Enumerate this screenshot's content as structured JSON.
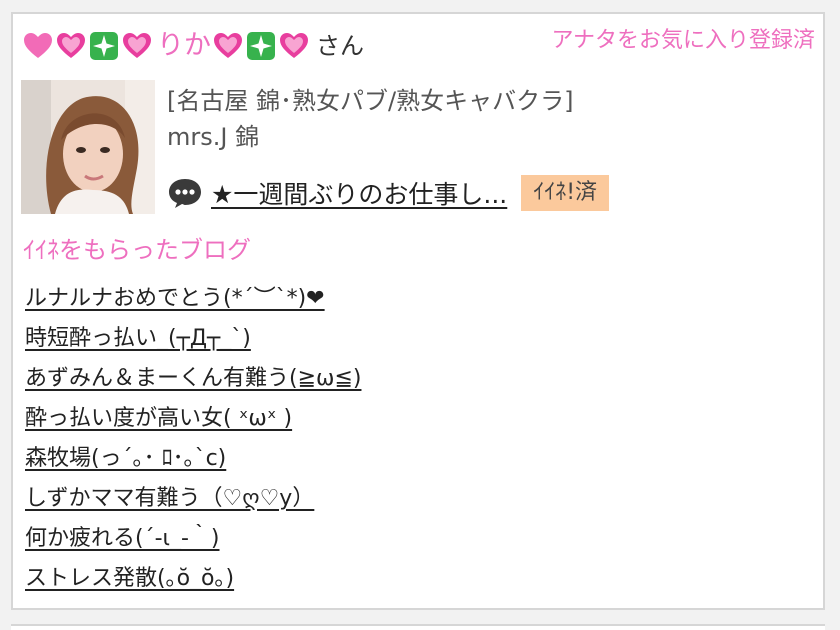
{
  "header": {
    "name": "りか",
    "honorific": "さん",
    "favorite_status": "アナタをお気に入り登録済"
  },
  "shop": {
    "category": "[名古屋 錦･熟女パブ/熟女キャバクラ]",
    "name": "mrs.J 錦"
  },
  "latest_blog": {
    "title": "★一週間ぶりのお仕事し...",
    "iine_badge": "ｲｲﾈ!済"
  },
  "liked_blogs": {
    "section_title": "ｲｲﾈをもらったブログ",
    "items": [
      "ルナルナおめでとう(*´︶`*)❤",
      "時短酔っ払い_(┬Д┬_`)",
      "あずみん＆まーくん有難う(≧ω≦)",
      "酔っ払い度が高い女( ˣωˣ )",
      "森牧場(っ´｡･ ﾛ･｡`c)",
      "しずかママ有難う（♡ღ♡y）",
      "何か疲れる(´-ι_-｀)",
      "ストレス発散(｡ŏ_ŏ｡)"
    ]
  },
  "colors": {
    "accent_pink": "#ee6fbf",
    "badge_bg": "#fbc99c"
  },
  "icons": [
    "pink-heart-icon",
    "sparkling-heart-icon",
    "sparkle-icon",
    "speech-bubble-icon"
  ]
}
